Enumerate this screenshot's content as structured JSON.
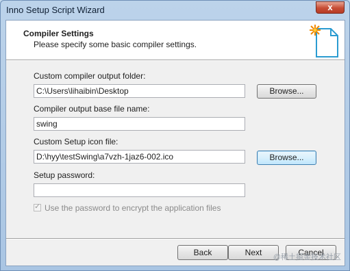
{
  "window": {
    "title": "Inno Setup Script Wizard",
    "close_glyph": "x"
  },
  "header": {
    "title": "Compiler Settings",
    "subtitle": "Please specify some basic compiler settings.",
    "icon": "wizard-page-icon"
  },
  "fields": {
    "output_folder": {
      "label": "Custom compiler output folder:",
      "value": "C:\\Users\\lihaibin\\Desktop",
      "browse_label": "Browse..."
    },
    "base_filename": {
      "label": "Compiler output base file name:",
      "value": "swing"
    },
    "icon_file": {
      "label": "Custom Setup icon file:",
      "value": "D:\\hyy\\testSwing\\a7vzh-1jaz6-002.ico",
      "browse_label": "Browse..."
    },
    "password": {
      "label": "Setup password:",
      "value": ""
    },
    "encrypt": {
      "label": "Use the password to encrypt the application files",
      "checked": true,
      "enabled": false
    }
  },
  "buttons": {
    "back": "Back",
    "next": "Next",
    "cancel": "Cancel"
  },
  "watermark": "@稀土掘金技术社区",
  "colors": {
    "title_bar": "#bcd3ea",
    "close_button": "#c74d35",
    "focus_border": "#3c7fb1"
  }
}
